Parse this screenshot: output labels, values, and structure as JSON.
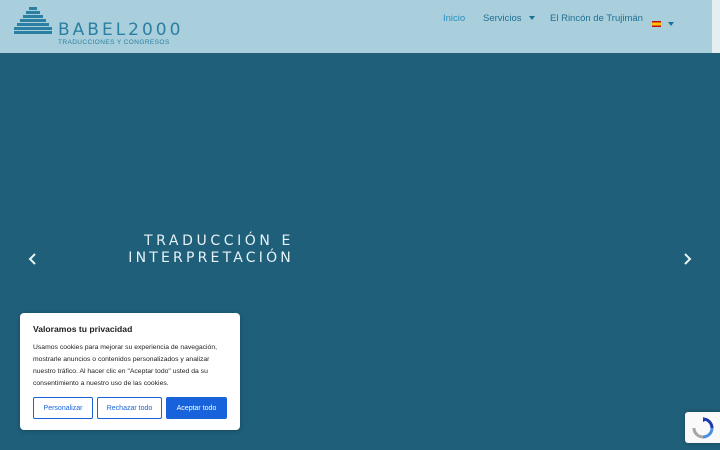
{
  "brand": {
    "name": "BABEL2000",
    "tagline": "TRADUCCIONES Y CONGRESOS",
    "color": "#2b7fa3"
  },
  "nav": {
    "items": [
      {
        "label": "Inicio",
        "active": true
      },
      {
        "label": "Servicios",
        "has_dropdown": true
      },
      {
        "label": "El Rincón de Trujimán"
      }
    ],
    "language": {
      "flag": "spain-flag-icon",
      "has_dropdown": true
    }
  },
  "hero": {
    "line1": "TRADUCCIÓN E",
    "line2": "INTERPRETACIÓN",
    "background": "#1f5f7a",
    "prev_icon": "chevron-left-icon",
    "next_icon": "chevron-right-icon"
  },
  "cookie_banner": {
    "title": "Valoramos tu privacidad",
    "text": "Usamos cookies para mejorar su experiencia de navegación, mostrarle anuncios o contenidos personalizados y analizar nuestro tráfico. Al hacer clic en \"Aceptar todo\" usted da su consentimiento a nuestro uso de las cookies.",
    "buttons": {
      "customize": "Personalizar",
      "reject": "Rechazar todo",
      "accept": "Aceptar todo"
    },
    "accent": "#1863dc"
  },
  "recaptcha": {
    "icon": "recaptcha-icon"
  }
}
